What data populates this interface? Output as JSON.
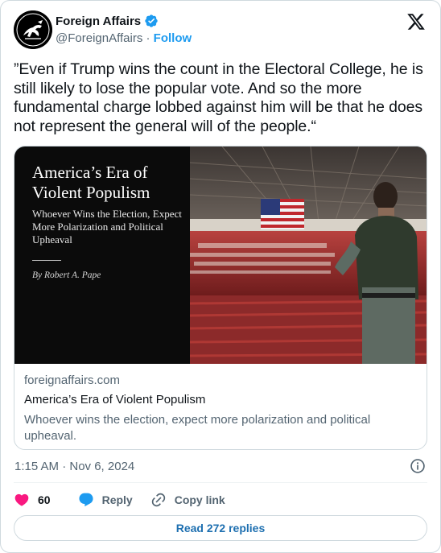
{
  "author": {
    "name": "Foreign Affairs",
    "handle": "@ForeignAffairs",
    "separator": "·",
    "follow_label": "Follow",
    "verified_color": "#1d9bf0"
  },
  "tweet": {
    "text": "”Even if Trump wins the count in the Electoral College, he is still likely to lose the popular vote. And so the more fundamental charge lobbed against him will be that he does not represent the general will of the people.“"
  },
  "link_card": {
    "cover_title": "America’s Era of Violent Populism",
    "cover_subtitle": "Whoever Wins the Election, Expect More Polarization and Political Upheaval",
    "cover_author": "By Robert A. Pape",
    "domain": "foreignaffairs.com",
    "title": "America’s Era of Violent Populism",
    "description": "Whoever wins the election, expect more polarization and political upheaval."
  },
  "timestamp": "1:15 AM · Nov 6, 2024",
  "actions": {
    "like_count": "60",
    "reply_label": "Reply",
    "copy_link_label": "Copy link",
    "like_color": "#f91880",
    "reply_color": "#1d9bf0"
  },
  "read_replies_label": "Read 272 replies",
  "icons": [
    "x-logo-icon",
    "verified-badge-icon",
    "info-icon",
    "heart-icon",
    "reply-bubble-icon",
    "link-icon"
  ]
}
